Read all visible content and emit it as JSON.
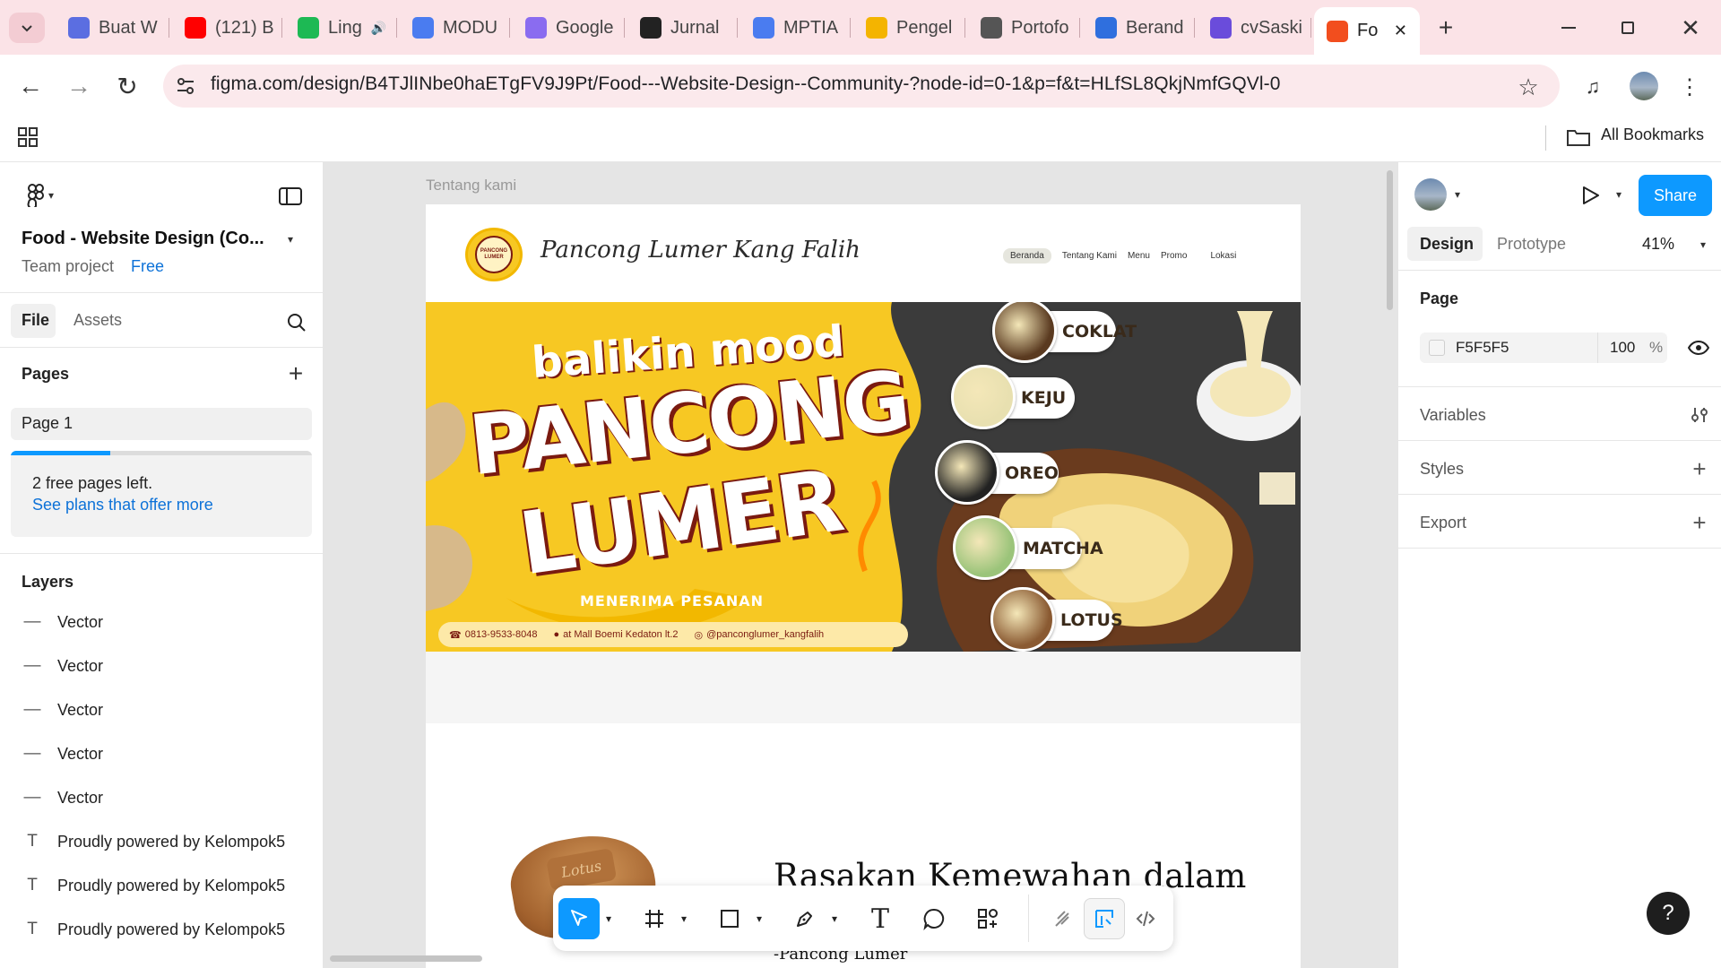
{
  "browser": {
    "tabs": [
      {
        "label": "Buat W",
        "color": "#5b6ee1"
      },
      {
        "label": "(121) B",
        "color": "#ff0000"
      },
      {
        "label": "Ling",
        "color": "#1db954"
      },
      {
        "label": "MODU",
        "color": "#4a7cf0"
      },
      {
        "label": "Google",
        "color": "#8a6cf0"
      },
      {
        "label": "Jurnal",
        "color": "#222222"
      },
      {
        "label": "MPTIA",
        "color": "#4a7cf0"
      },
      {
        "label": "Pengel",
        "color": "#f4b400"
      },
      {
        "label": "Portofo",
        "color": "#555555"
      },
      {
        "label": "Berand",
        "color": "#2f6fde"
      },
      {
        "label": "cvSaski",
        "color": "#6a4cdb"
      },
      {
        "label": "Fo",
        "color": "#f24e1e"
      }
    ],
    "url": "figma.com/design/B4TJlINbe0haETgFV9J9Pt/Food---Website-Design--Community-?node-id=0-1&p=f&t=HLfSL8QkjNmfGQVl-0",
    "all_bookmarks": "All Bookmarks"
  },
  "left_panel": {
    "file_title": "Food - Website Design (Co...",
    "team": "Team project",
    "plan": "Free",
    "tab_file": "File",
    "tab_assets": "Assets",
    "pages_label": "Pages",
    "page1": "Page 1",
    "free_pages": "2 free pages left.",
    "see_plans": "See plans that offer more",
    "free_pages_used_fraction": 0.33,
    "layers_label": "Layers",
    "layers": [
      {
        "icon": "vector",
        "name": "Vector"
      },
      {
        "icon": "vector",
        "name": "Vector"
      },
      {
        "icon": "vector",
        "name": "Vector"
      },
      {
        "icon": "vector",
        "name": "Vector"
      },
      {
        "icon": "vector",
        "name": "Vector"
      },
      {
        "icon": "text",
        "name": "Proudly powered by Kelompok5"
      },
      {
        "icon": "text",
        "name": "Proudly powered by Kelompok5"
      },
      {
        "icon": "text",
        "name": "Proudly powered by Kelompok5"
      }
    ]
  },
  "right_panel": {
    "share": "Share",
    "tab_design": "Design",
    "tab_prototype": "Prototype",
    "zoom": "41%",
    "page_label": "Page",
    "page_color": "F5F5F5",
    "page_opacity": "100",
    "percent": "%",
    "variables": "Variables",
    "styles": "Styles",
    "export": "Export"
  },
  "canvas": {
    "frame_label": "Tentang kami",
    "site": {
      "brand": "Pancong Lumer Kang Falih",
      "logo_text": "PANCONG LUMER",
      "nav": [
        "Beranda",
        "Tentang Kami",
        "Menu",
        "Promo",
        "Lokasi"
      ],
      "hero": {
        "tagline": "balikin mood",
        "title1": "PANCONG",
        "title2": "LUMER",
        "subtitle": "MENERIMA PESANAN",
        "phone": "0813-9533-8048",
        "location": "at Mall Boemi Kedaton lt.2",
        "instagram": "@panconglumer_kangfalih",
        "flavors": [
          "COKLAT",
          "KEJU",
          "OREO",
          "MATCHA",
          "LOTUS"
        ]
      },
      "about_heading": "Rasakan Kemewahan dalam",
      "about_sign": "-Pancong Lumer",
      "lotus_text": "Lotus"
    }
  },
  "help": "?"
}
